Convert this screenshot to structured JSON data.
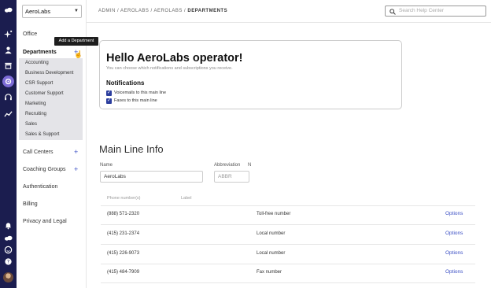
{
  "rail": {
    "icons": [
      "cloud-logo-icon",
      "sparkle-icon",
      "user-icon",
      "building-icon",
      "settings-icon",
      "headset-icon",
      "trend-icon"
    ],
    "bottom_icons": [
      "bell-icon",
      "cloud-icon",
      "smile-icon",
      "help-icon"
    ]
  },
  "sidebar": {
    "org_name": "AeroLabs",
    "office": "Office",
    "departments": "Departments",
    "department_items": [
      "Accounting",
      "Business Development",
      "CSR Support",
      "Customer Support",
      "Marketing",
      "Recruiting",
      "Sales",
      "Sales & Support"
    ],
    "call_centers": "Call Centers",
    "coaching_groups": "Coaching Groups",
    "authentication": "Authentication",
    "billing": "Billing",
    "privacy": "Privacy and Legal",
    "tooltip": "Add a Department"
  },
  "header": {
    "breadcrumb_prefix": "ADMIN / AEROLABS / AEROLABS / ",
    "breadcrumb_current": "DEPARTMENTS",
    "search_placeholder": "Search Help Center"
  },
  "welcome": {
    "title": "Hello AeroLabs operator!",
    "description": "You can choose which notifications and subscriptions you receive.",
    "notifications_heading": "Notifications",
    "voicemails": "Voicemails to this main line",
    "faxes": "Faxes to this main line"
  },
  "main_line": {
    "heading": "Main Line Info",
    "name_label": "Name",
    "name_value": "AeroLabs",
    "abbr_label": "Abbreviation",
    "abbr_marker": "N",
    "abbr_placeholder": "ABBR"
  },
  "table": {
    "headers": [
      "Phone number(s)",
      "Label"
    ],
    "rows": [
      {
        "number": "(888) 571-2320",
        "type": "Toll-free number",
        "action": "Options"
      },
      {
        "number": "(415) 231-2374",
        "type": "Local number",
        "action": "Options"
      },
      {
        "number": "(415) 226-9073",
        "type": "Local number",
        "action": "Options"
      },
      {
        "number": "(415) 484-7909",
        "type": "Fax number",
        "action": "Options"
      }
    ]
  },
  "colors": {
    "rail_bg": "#1b1d4f",
    "accent": "#3a4ec4",
    "active_icon": "#7c6bd6"
  }
}
